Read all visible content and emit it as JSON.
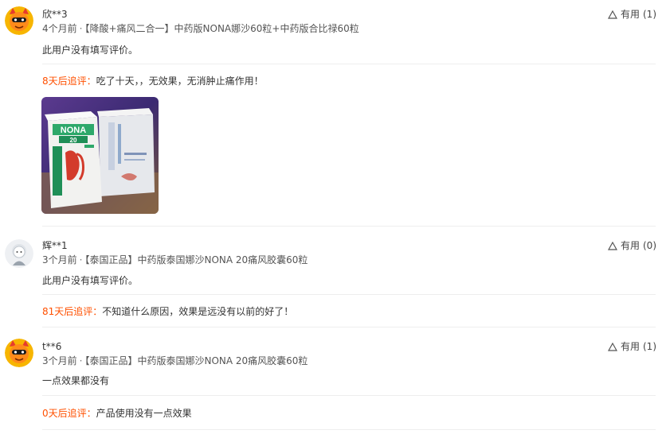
{
  "reviews": [
    {
      "username": "欣**3",
      "time": "4个月前",
      "sku": "【降酸+痛风二合一】中药版NONA娜沙60粒+中药版合比禄60粒",
      "content": "此用户没有填写评价。",
      "followup_label": "8天后追评：",
      "followup_text": "吃了十天，，无效果，无消肿止痛作用！",
      "useful_label": "有用",
      "useful_count": "(1)",
      "photo": {
        "box1_text": "NONA",
        "box1_number": "20"
      }
    },
    {
      "username": "辉**1",
      "time": "3个月前",
      "sku": "【泰国正品】中药版泰国娜沙NONA 20痛风胶囊60粒",
      "content": "此用户没有填写评价。",
      "followup_label": "81天后追评：",
      "followup_text": "不知道什么原因，效果是远没有以前的好了！",
      "useful_label": "有用",
      "useful_count": "(0)"
    },
    {
      "username": "t**6",
      "time": "3个月前",
      "sku": "【泰国正品】中药版泰国娜沙NONA 20痛风胶囊60粒",
      "content": "一点效果都没有",
      "followup_label": "0天后追评：",
      "followup_text": "产品使用没有一点效果",
      "useful_label": "有用",
      "useful_count": "(1)"
    }
  ],
  "meta_separator": "·",
  "colors": {
    "followup_label": "#ff5000",
    "divider": "#eeeeee",
    "text": "#333333"
  }
}
